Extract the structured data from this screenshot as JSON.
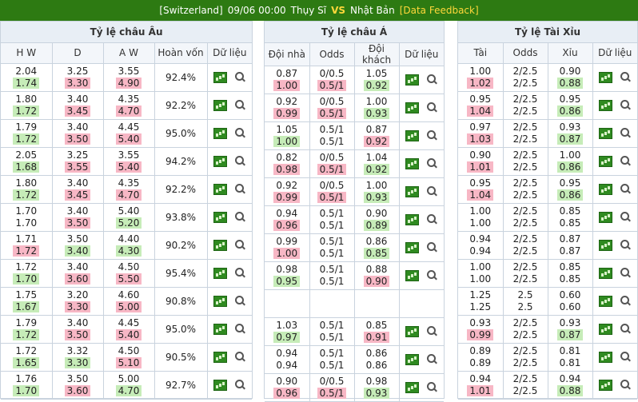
{
  "header": {
    "team_home": "[Switzerland]",
    "datetime": "09/06 00:00",
    "home_name": "Thụy Sĩ",
    "vs": "VS",
    "away_name": "Nhật Bản",
    "feedback": "[Data Feedback]"
  },
  "colors": {
    "header_bg": "#2d7a12",
    "accent": "#ffd83a",
    "highlight_up": "#f7b7c5",
    "highlight_down": "#c6ecb8"
  },
  "icons": {
    "chart": "chart-icon",
    "search": "search-icon"
  },
  "european": {
    "title": "Tỷ lệ châu Âu",
    "columns": [
      "H W",
      "D",
      "A W",
      "Hoàn vốn",
      "Dữ liệu"
    ],
    "rows": [
      {
        "hw": [
          "2.04",
          "1.74"
        ],
        "d": [
          "3.25",
          "3.30"
        ],
        "aw": [
          "3.55",
          "4.90"
        ],
        "ret": "92.4%",
        "hl": [
          0,
          1,
          1
        ]
      },
      {
        "hw": [
          "1.80",
          "1.72"
        ],
        "d": [
          "3.40",
          "3.45"
        ],
        "aw": [
          "4.35",
          "4.70"
        ],
        "ret": "92.2%",
        "hl": [
          0,
          1,
          1
        ]
      },
      {
        "hw": [
          "1.79",
          "1.72"
        ],
        "d": [
          "3.40",
          "3.50"
        ],
        "aw": [
          "4.45",
          "5.40"
        ],
        "ret": "95.0%",
        "hl": [
          0,
          1,
          1
        ]
      },
      {
        "hw": [
          "2.05",
          "1.68"
        ],
        "d": [
          "3.25",
          "3.55"
        ],
        "aw": [
          "3.55",
          "5.40"
        ],
        "ret": "94.2%",
        "hl": [
          0,
          1,
          1
        ]
      },
      {
        "hw": [
          "1.80",
          "1.72"
        ],
        "d": [
          "3.40",
          "3.45"
        ],
        "aw": [
          "4.35",
          "4.70"
        ],
        "ret": "92.2%",
        "hl": [
          0,
          1,
          1
        ]
      },
      {
        "hw": [
          "1.70",
          "1.70"
        ],
        "d": [
          "3.40",
          "3.50"
        ],
        "aw": [
          "5.40",
          "5.20"
        ],
        "ret": "93.8%",
        "hl": [
          0,
          1,
          0
        ]
      },
      {
        "hw": [
          "1.71",
          "1.72"
        ],
        "d": [
          "3.50",
          "3.40"
        ],
        "aw": [
          "4.40",
          "4.30"
        ],
        "ret": "90.2%",
        "hl": [
          1,
          0,
          0
        ]
      },
      {
        "hw": [
          "1.72",
          "1.70"
        ],
        "d": [
          "3.40",
          "3.60"
        ],
        "aw": [
          "4.50",
          "5.50"
        ],
        "ret": "95.4%",
        "hl": [
          0,
          1,
          1
        ]
      },
      {
        "hw": [
          "1.75",
          "1.67"
        ],
        "d": [
          "3.20",
          "3.30"
        ],
        "aw": [
          "4.60",
          "5.00"
        ],
        "ret": "90.8%",
        "hl": [
          0,
          1,
          1
        ]
      },
      {
        "hw": [
          "1.79",
          "1.72"
        ],
        "d": [
          "3.40",
          "3.50"
        ],
        "aw": [
          "4.45",
          "5.40"
        ],
        "ret": "95.0%",
        "hl": [
          0,
          1,
          1
        ]
      },
      {
        "hw": [
          "1.72",
          "1.65"
        ],
        "d": [
          "3.32",
          "3.30"
        ],
        "aw": [
          "4.50",
          "5.10"
        ],
        "ret": "90.5%",
        "hl": [
          0,
          0,
          1
        ]
      },
      {
        "hw": [
          "1.76",
          "1.70"
        ],
        "d": [
          "3.50",
          "3.60"
        ],
        "aw": [
          "5.00",
          "4.70"
        ],
        "ret": "92.7%",
        "hl": [
          0,
          1,
          0
        ]
      }
    ]
  },
  "asian": {
    "title": "Tỷ lệ châu Á",
    "columns": [
      "Đội nhà",
      "Odds",
      "Đội khách",
      "Dữ liệu"
    ],
    "rows": [
      {
        "home": [
          "0.87",
          "1.00"
        ],
        "odds": [
          "0/0.5",
          "0.5/1"
        ],
        "away": [
          "1.05",
          "0.92"
        ],
        "hl": [
          1,
          1,
          0
        ]
      },
      {
        "home": [
          "0.92",
          "0.99"
        ],
        "odds": [
          "0/0.5",
          "0.5/1"
        ],
        "away": [
          "1.00",
          "0.93"
        ],
        "hl": [
          1,
          1,
          0
        ]
      },
      {
        "home": [
          "1.05",
          "1.00"
        ],
        "odds": [
          "0.5/1",
          "0.5/1"
        ],
        "away": [
          "0.87",
          "0.92"
        ],
        "hl": [
          0,
          0,
          1
        ]
      },
      {
        "home": [
          "0.82",
          "0.98"
        ],
        "odds": [
          "0/0.5",
          "0.5/1"
        ],
        "away": [
          "1.04",
          "0.92"
        ],
        "hl": [
          1,
          1,
          0
        ]
      },
      {
        "home": [
          "0.92",
          "0.99"
        ],
        "odds": [
          "0/0.5",
          "0.5/1"
        ],
        "away": [
          "1.00",
          "0.93"
        ],
        "hl": [
          1,
          1,
          0
        ]
      },
      {
        "home": [
          "0.94",
          "0.96"
        ],
        "odds": [
          "0.5/1",
          "0.5/1"
        ],
        "away": [
          "0.90",
          "0.89"
        ],
        "hl": [
          1,
          0,
          0
        ]
      },
      {
        "home": [
          "0.99",
          "1.00"
        ],
        "odds": [
          "0.5/1",
          "0.5/1"
        ],
        "away": [
          "0.86",
          "0.85"
        ],
        "hl": [
          1,
          0,
          0
        ]
      },
      {
        "home": [
          "0.98",
          "0.95"
        ],
        "odds": [
          "0.5/1",
          "0.5/1"
        ],
        "away": [
          "0.88",
          "0.90"
        ],
        "hl": [
          0,
          0,
          1
        ]
      },
      {
        "home": [
          "",
          ""
        ],
        "odds": [
          "",
          ""
        ],
        "away": [
          "",
          ""
        ],
        "hl": [
          0,
          0,
          0
        ],
        "empty": true
      },
      {
        "home": [
          "1.03",
          "0.97"
        ],
        "odds": [
          "0.5/1",
          "0.5/1"
        ],
        "away": [
          "0.85",
          "0.91"
        ],
        "hl": [
          0,
          0,
          1
        ]
      },
      {
        "home": [
          "0.94",
          "0.94"
        ],
        "odds": [
          "0.5/1",
          "0.5/1"
        ],
        "away": [
          "0.86",
          "0.86"
        ],
        "hl": [
          0,
          0,
          0
        ]
      },
      {
        "home": [
          "0.90",
          "0.96"
        ],
        "odds": [
          "0/0.5",
          "0.5/1"
        ],
        "away": [
          "0.98",
          "0.93"
        ],
        "hl": [
          1,
          1,
          0
        ]
      }
    ]
  },
  "overunder": {
    "title": "Tỷ lệ Tài Xỉu",
    "columns": [
      "Tài",
      "Odds",
      "Xỉu",
      "Dữ liệu"
    ],
    "rows": [
      {
        "over": [
          "1.00",
          "1.02"
        ],
        "odds": [
          "2/2.5",
          "2/2.5"
        ],
        "under": [
          "0.90",
          "0.88"
        ],
        "hl": [
          1,
          0,
          0
        ]
      },
      {
        "over": [
          "0.95",
          "1.04"
        ],
        "odds": [
          "2/2.5",
          "2/2.5"
        ],
        "under": [
          "0.95",
          "0.86"
        ],
        "hl": [
          1,
          0,
          0
        ]
      },
      {
        "over": [
          "0.97",
          "1.03"
        ],
        "odds": [
          "2/2.5",
          "2/2.5"
        ],
        "under": [
          "0.93",
          "0.87"
        ],
        "hl": [
          1,
          0,
          0
        ]
      },
      {
        "over": [
          "0.90",
          "1.01"
        ],
        "odds": [
          "2/2.5",
          "2/2.5"
        ],
        "under": [
          "1.00",
          "0.86"
        ],
        "hl": [
          1,
          0,
          0
        ]
      },
      {
        "over": [
          "0.95",
          "1.04"
        ],
        "odds": [
          "2/2.5",
          "2/2.5"
        ],
        "under": [
          "0.95",
          "0.86"
        ],
        "hl": [
          1,
          0,
          0
        ]
      },
      {
        "over": [
          "1.00",
          "1.00"
        ],
        "odds": [
          "2/2.5",
          "2/2.5"
        ],
        "under": [
          "0.85",
          "0.85"
        ],
        "hl": [
          0,
          0,
          0
        ]
      },
      {
        "over": [
          "0.94",
          "0.94"
        ],
        "odds": [
          "2/2.5",
          "2/2.5"
        ],
        "under": [
          "0.87",
          "0.87"
        ],
        "hl": [
          0,
          0,
          0
        ]
      },
      {
        "over": [
          "1.00",
          "1.00"
        ],
        "odds": [
          "2/2.5",
          "2/2.5"
        ],
        "under": [
          "0.85",
          "0.85"
        ],
        "hl": [
          0,
          0,
          0
        ]
      },
      {
        "over": [
          "1.25",
          "1.25"
        ],
        "odds": [
          "2.5",
          "2.5"
        ],
        "under": [
          "0.60",
          "0.60"
        ],
        "hl": [
          0,
          0,
          0
        ]
      },
      {
        "over": [
          "0.93",
          "0.99"
        ],
        "odds": [
          "2/2.5",
          "2/2.5"
        ],
        "under": [
          "0.93",
          "0.87"
        ],
        "hl": [
          1,
          0,
          0
        ]
      },
      {
        "over": [
          "0.89",
          "0.89"
        ],
        "odds": [
          "2/2.5",
          "2/2.5"
        ],
        "under": [
          "0.81",
          "0.81"
        ],
        "hl": [
          0,
          0,
          0
        ]
      },
      {
        "over": [
          "0.94",
          "1.01"
        ],
        "odds": [
          "2/2.5",
          "2/2.5"
        ],
        "under": [
          "0.94",
          "0.88"
        ],
        "hl": [
          1,
          0,
          0
        ]
      }
    ]
  }
}
